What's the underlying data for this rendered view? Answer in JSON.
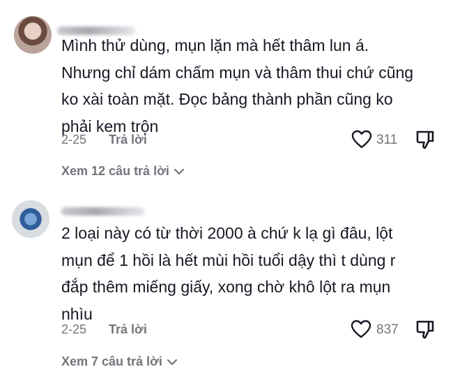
{
  "comments": [
    {
      "avatar_icon": "user-avatar",
      "text": "Mình thử dùng, mụn lặn mà hết thâm lun á.\nNhưng chỉ dám chấm mụn và thâm thui chứ cũng\nko xài toàn mặt. Đọc bảng thành phần cũng ko\nphải kem trộn",
      "date": "2-25",
      "reply_label": "Trả lời",
      "like_icon": "heart-outline-icon",
      "likes": "311",
      "dislike_icon": "thumbs-down-icon",
      "view_replies": "Xem 12 câu trả lời",
      "chevron_icon": "chevron-down-icon"
    },
    {
      "avatar_icon": "user-avatar",
      "text": "2 loại này có từ thời 2000 à chứ k lạ gì đâu, lột\nmụn để 1 hồi là hết mùi hồi tuổi dậy thì t dùng r\nđắp thêm miếng giấy, xong chờ khô lột ra mụn\nnhìu",
      "date": "2-25",
      "reply_label": "Trả lời",
      "like_icon": "heart-outline-icon",
      "likes": "837",
      "dislike_icon": "thumbs-down-icon",
      "view_replies": "Xem 7 câu trả lời",
      "chevron_icon": "chevron-down-icon"
    }
  ],
  "colors": {
    "text": "#161823",
    "muted": "#73747b",
    "background": "#ffffff"
  }
}
